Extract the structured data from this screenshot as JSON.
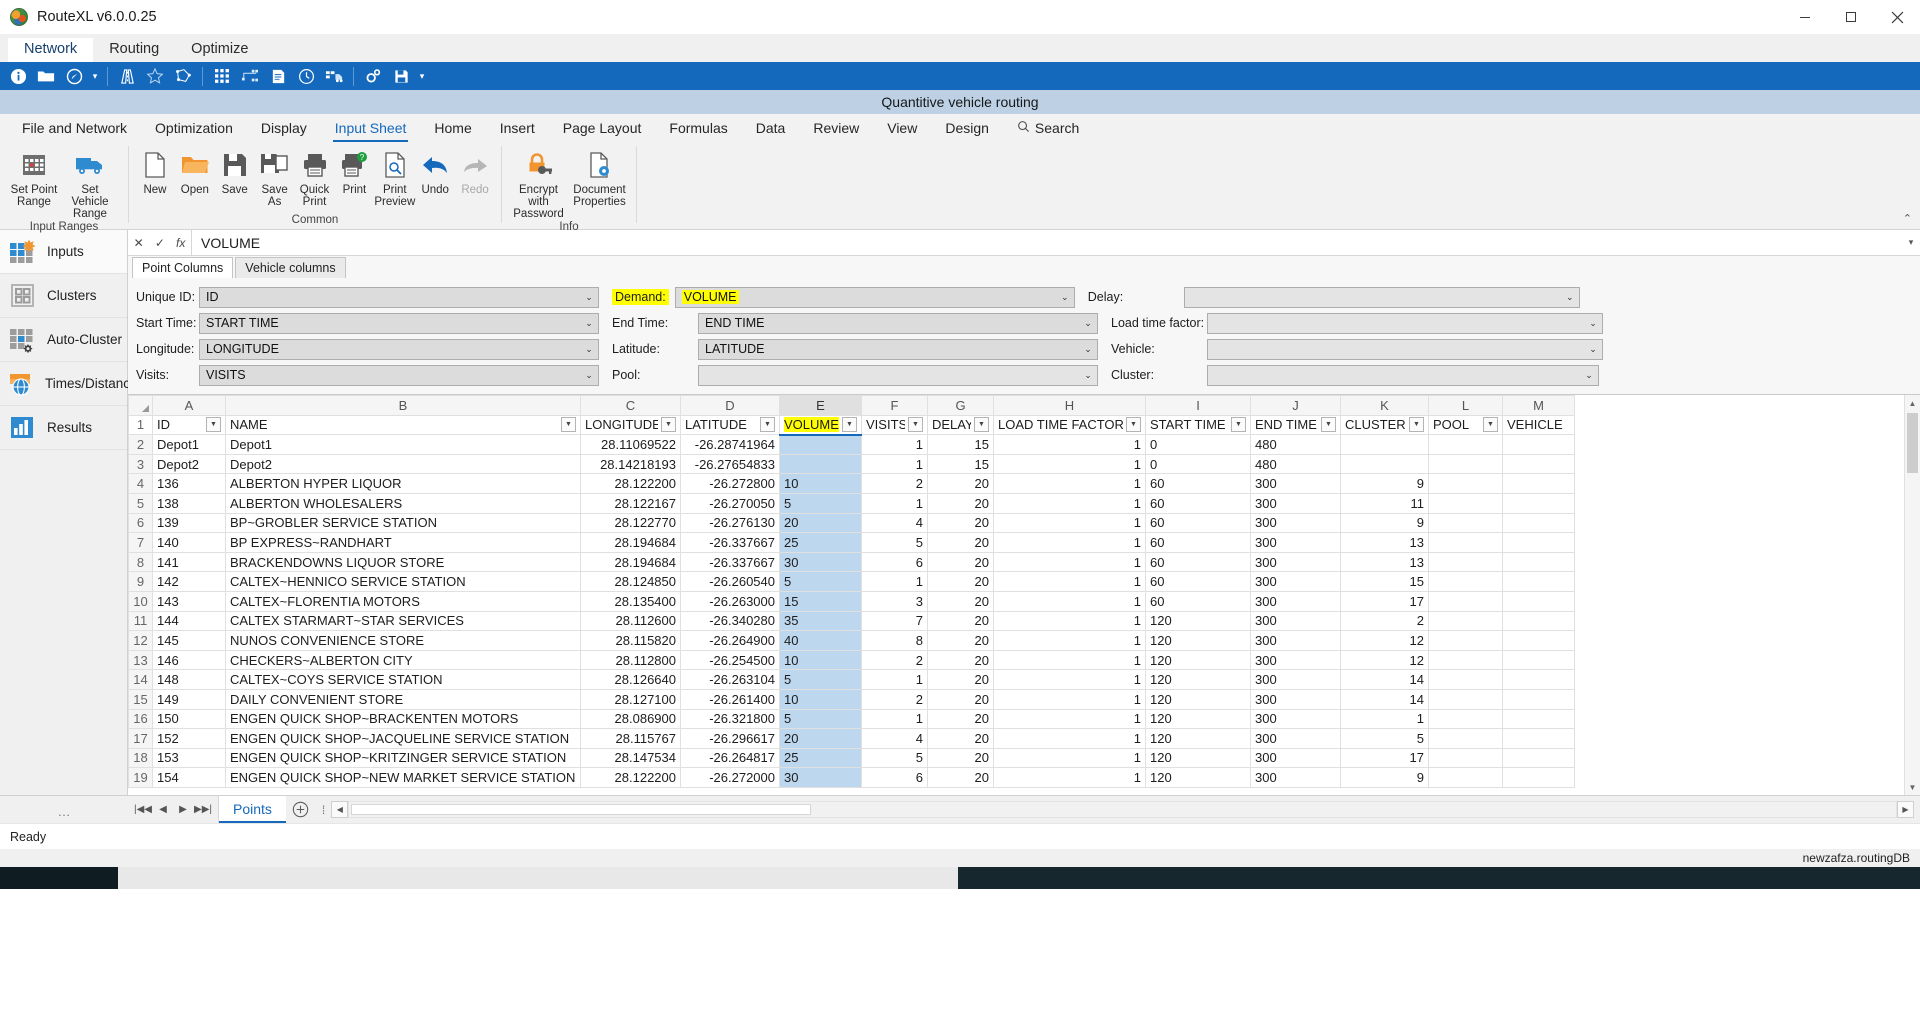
{
  "window": {
    "app_title": "RouteXL v6.0.0.25",
    "icon": "app-globe-icon",
    "buttons": {
      "minimize": "minimize-button",
      "maximize": "maximize-button",
      "close": "close-button"
    }
  },
  "app_menu": {
    "items": [
      "Network",
      "Routing",
      "Optimize"
    ],
    "active": "Network"
  },
  "blue_toolbar": {
    "icons": [
      "info-icon",
      "folder-icon",
      "compass-icon",
      "caret-down-icon",
      "road-icon",
      "star-outline-icon",
      "polygon-icon",
      "matrix-grid-icon",
      "network-nodes-icon",
      "report-icon",
      "clock-icon",
      "truck-schedule-icon",
      "settings-gears-icon",
      "save-disk-icon",
      "caret-down-icon-2"
    ]
  },
  "document_title": "Quantitive vehicle routing",
  "ribbon_tabs": {
    "items": [
      "File and Network",
      "Optimization",
      "Display",
      "Input Sheet",
      "Home",
      "Insert",
      "Page Layout",
      "Formulas",
      "Data",
      "Review",
      "View",
      "Design"
    ],
    "active": "Input Sheet",
    "search_label": "Search",
    "search_icon": "search-icon"
  },
  "ribbon": {
    "groups": [
      {
        "label": "Input Ranges",
        "buttons": [
          {
            "label": "Set Point Range",
            "icon": "point-range-grid-icon"
          },
          {
            "label": "Set Vehicle Range",
            "icon": "truck-icon"
          }
        ]
      },
      {
        "label": "Common",
        "buttons": [
          {
            "label": "New",
            "icon": "new-document-icon"
          },
          {
            "label": "Open",
            "icon": "open-folder-icon"
          },
          {
            "label": "Save",
            "icon": "save-floppy-icon"
          },
          {
            "label": "Save As",
            "icon": "save-as-icon"
          },
          {
            "label": "Quick Print",
            "icon": "quick-print-icon"
          },
          {
            "label": "Print",
            "icon": "print-help-icon"
          },
          {
            "label": "Print Preview",
            "icon": "print-preview-icon"
          },
          {
            "label": "Undo",
            "icon": "undo-arrow-icon"
          },
          {
            "label": "Redo",
            "icon": "redo-arrow-icon",
            "disabled": true
          }
        ]
      },
      {
        "label": "Info",
        "buttons": [
          {
            "label": "Encrypt with Password",
            "icon": "lock-key-icon"
          },
          {
            "label": "Document Properties",
            "icon": "document-properties-icon"
          }
        ]
      }
    ],
    "collapse_icon": "collapse-ribbon-icon"
  },
  "sidebar": {
    "items": [
      {
        "label": "Inputs",
        "icon": "inputs-grid-icon",
        "active": true
      },
      {
        "label": "Clusters",
        "icon": "clusters-icon",
        "active": false
      },
      {
        "label": "Auto-Cluster",
        "icon": "auto-cluster-icon",
        "active": false
      },
      {
        "label": "Times/Distances",
        "icon": "times-distances-globe-icon",
        "active": false
      },
      {
        "label": "Results",
        "icon": "results-chart-icon",
        "active": false
      }
    ]
  },
  "formula_bar": {
    "cancel_icon": "cancel-x-icon",
    "confirm_icon": "confirm-check-icon",
    "function_icon": "insert-function-icon",
    "value": "VOLUME",
    "expand_icon": "expand-formula-bar-icon"
  },
  "point_panel": {
    "tabs": [
      {
        "label": "Point Columns",
        "active": true
      },
      {
        "label": "Vehicle columns",
        "active": false
      }
    ],
    "fields": {
      "unique_id": {
        "label": "Unique ID:",
        "value": "ID"
      },
      "demand": {
        "label": "Demand:",
        "value": "VOLUME",
        "highlight": true
      },
      "delay": {
        "label": "Delay:",
        "value": ""
      },
      "start_time": {
        "label": "Start Time:",
        "value": "START TIME"
      },
      "end_time": {
        "label": "End Time:",
        "value": "END TIME"
      },
      "load_time_factor": {
        "label": "Load time factor:",
        "value": ""
      },
      "longitude": {
        "label": "Longitude:",
        "value": "LONGITUDE"
      },
      "latitude": {
        "label": "Latitude:",
        "value": "LATITUDE"
      },
      "vehicle": {
        "label": "Vehicle:",
        "value": ""
      },
      "visits": {
        "label": "Visits:",
        "value": "VISITS"
      },
      "pool": {
        "label": "Pool:",
        "value": ""
      },
      "cluster": {
        "label": "Cluster:",
        "value": ""
      }
    }
  },
  "sheet": {
    "column_letters": [
      "A",
      "B",
      "C",
      "D",
      "E",
      "F",
      "G",
      "H",
      "I",
      "J",
      "K",
      "L",
      "M"
    ],
    "selected_column": "E",
    "headers": [
      "ID",
      "NAME",
      "LONGITUDE",
      "LATITUDE",
      "VOLUME",
      "VISITS",
      "DELAY",
      "LOAD TIME FACTOR",
      "START TIME",
      "END TIME",
      "CLUSTER",
      "POOL",
      "VEHICLE"
    ],
    "highlighted_header": "VOLUME",
    "rows": [
      {
        "n": 2,
        "cells": [
          "Depot1",
          "Depot1",
          "28.11069522",
          "-26.28741964",
          "",
          "1",
          "15",
          "1",
          "0",
          "480",
          "",
          "",
          ""
        ]
      },
      {
        "n": 3,
        "cells": [
          "Depot2",
          "Depot2",
          "28.14218193",
          "-26.27654833",
          "",
          "1",
          "15",
          "1",
          "0",
          "480",
          "",
          "",
          ""
        ]
      },
      {
        "n": 4,
        "cells": [
          "136",
          "ALBERTON HYPER LIQUOR",
          "28.122200",
          "-26.272800",
          "10",
          "2",
          "20",
          "1",
          "60",
          "300",
          "9",
          "",
          ""
        ]
      },
      {
        "n": 5,
        "cells": [
          "138",
          "ALBERTON WHOLESALERS",
          "28.122167",
          "-26.270050",
          "5",
          "1",
          "20",
          "1",
          "60",
          "300",
          "11",
          "",
          ""
        ]
      },
      {
        "n": 6,
        "cells": [
          "139",
          "BP~GROBLER SERVICE STATION",
          "28.122770",
          "-26.276130",
          "20",
          "4",
          "20",
          "1",
          "60",
          "300",
          "9",
          "",
          ""
        ]
      },
      {
        "n": 7,
        "cells": [
          "140",
          "BP EXPRESS~RANDHART",
          "28.194684",
          "-26.337667",
          "25",
          "5",
          "20",
          "1",
          "60",
          "300",
          "13",
          "",
          ""
        ]
      },
      {
        "n": 8,
        "cells": [
          "141",
          "BRACKENDOWNS LIQUOR STORE",
          "28.194684",
          "-26.337667",
          "30",
          "6",
          "20",
          "1",
          "60",
          "300",
          "13",
          "",
          ""
        ]
      },
      {
        "n": 9,
        "cells": [
          "142",
          "CALTEX~HENNICO SERVICE STATION",
          "28.124850",
          "-26.260540",
          "5",
          "1",
          "20",
          "1",
          "60",
          "300",
          "15",
          "",
          ""
        ]
      },
      {
        "n": 10,
        "cells": [
          "143",
          "CALTEX~FLORENTIA MOTORS",
          "28.135400",
          "-26.263000",
          "15",
          "3",
          "20",
          "1",
          "60",
          "300",
          "17",
          "",
          ""
        ]
      },
      {
        "n": 11,
        "cells": [
          "144",
          "CALTEX STARMART~STAR SERVICES",
          "28.112600",
          "-26.340280",
          "35",
          "7",
          "20",
          "1",
          "120",
          "300",
          "2",
          "",
          ""
        ]
      },
      {
        "n": 12,
        "cells": [
          "145",
          "NUNOS CONVENIENCE STORE",
          "28.115820",
          "-26.264900",
          "40",
          "8",
          "20",
          "1",
          "120",
          "300",
          "12",
          "",
          ""
        ]
      },
      {
        "n": 13,
        "cells": [
          "146",
          "CHECKERS~ALBERTON CITY",
          "28.112800",
          "-26.254500",
          "10",
          "2",
          "20",
          "1",
          "120",
          "300",
          "12",
          "",
          ""
        ]
      },
      {
        "n": 14,
        "cells": [
          "148",
          "CALTEX~COYS SERVICE STATION",
          "28.126640",
          "-26.263104",
          "5",
          "1",
          "20",
          "1",
          "120",
          "300",
          "14",
          "",
          ""
        ]
      },
      {
        "n": 15,
        "cells": [
          "149",
          "DAILY CONVENIENT STORE",
          "28.127100",
          "-26.261400",
          "10",
          "2",
          "20",
          "1",
          "120",
          "300",
          "14",
          "",
          ""
        ]
      },
      {
        "n": 16,
        "cells": [
          "150",
          "ENGEN QUICK SHOP~BRACKENTEN MOTORS",
          "28.086900",
          "-26.321800",
          "5",
          "1",
          "20",
          "1",
          "120",
          "300",
          "1",
          "",
          ""
        ]
      },
      {
        "n": 17,
        "cells": [
          "152",
          "ENGEN QUICK SHOP~JACQUELINE SERVICE STATION",
          "28.115767",
          "-26.296617",
          "20",
          "4",
          "20",
          "1",
          "120",
          "300",
          "5",
          "",
          ""
        ]
      },
      {
        "n": 18,
        "cells": [
          "153",
          "ENGEN QUICK SHOP~KRITZINGER SERVICE STATION",
          "28.147534",
          "-26.264817",
          "25",
          "5",
          "20",
          "1",
          "120",
          "300",
          "17",
          "",
          ""
        ]
      },
      {
        "n": 19,
        "cells": [
          "154",
          "ENGEN QUICK SHOP~NEW MARKET SERVICE STATION",
          "28.122200",
          "-26.272000",
          "30",
          "6",
          "20",
          "1",
          "120",
          "300",
          "9",
          "",
          ""
        ]
      }
    ]
  },
  "tab_bar": {
    "nav_first": "first-sheet-icon",
    "nav_prev": "previous-sheet-icon",
    "nav_next": "next-sheet-icon",
    "nav_last": "last-sheet-icon",
    "sheets": [
      {
        "label": "Points",
        "active": true
      }
    ],
    "add_sheet_icon": "add-sheet-icon",
    "overflow_icon": "more-options-icon"
  },
  "status_bar": {
    "text": "Ready"
  },
  "database_bar": {
    "text": "newzafza.routingDB"
  },
  "colors": {
    "accent_blue": "#1569bd",
    "highlight_yellow": "#ffff00",
    "selection_blue": "#bdd7ee",
    "title_strip": "#bdd0e4",
    "orange": "#ed7d31"
  }
}
